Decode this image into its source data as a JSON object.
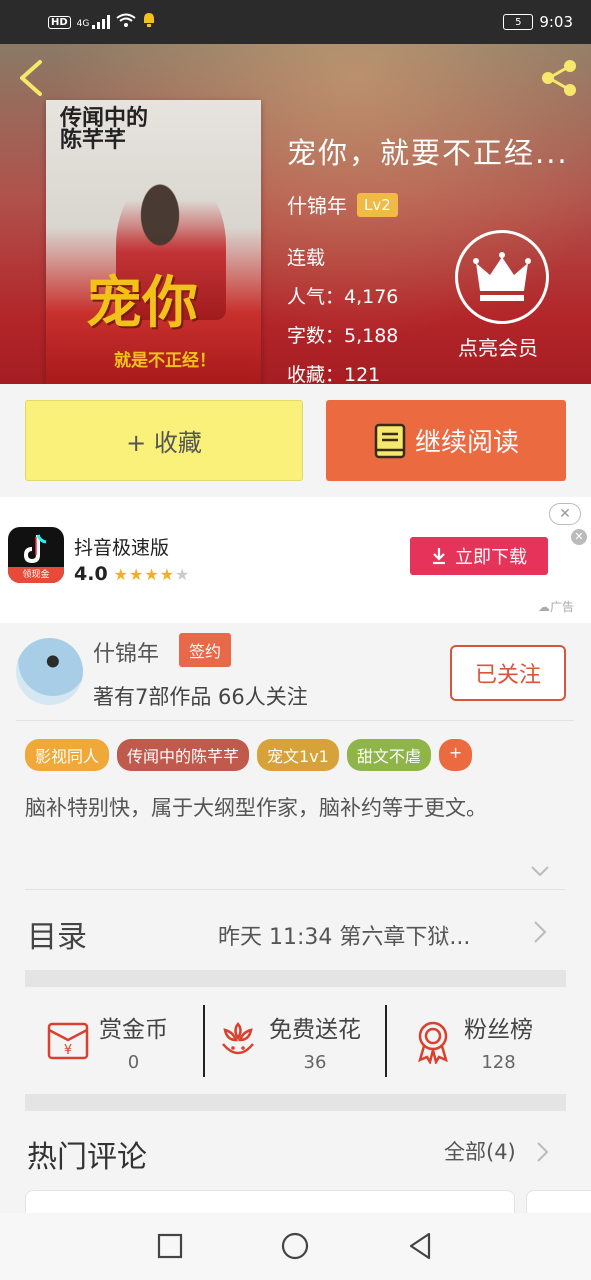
{
  "status_bar": {
    "network_tag": "HD",
    "signal": "4G",
    "battery": "5",
    "time": "9:03"
  },
  "book": {
    "title": "宠你，就要不正经...",
    "author": "什锦年",
    "level": "Lv2",
    "status": "连载",
    "popularity": "人气：4,176",
    "word_count": "字数：5,188",
    "favorites": "收藏：121",
    "vip_label": "点亮会员",
    "cover_title": "传闻中的陈芊芊",
    "cover_big": "宠你",
    "cover_sub": "就是不正经！"
  },
  "actions": {
    "collect_label": "+ 收藏",
    "read_label": "继续阅读"
  },
  "ad": {
    "app_name": "抖音极速版",
    "rating": "4.0",
    "icon_badge": "领现金",
    "download_label": "立即下载",
    "ad_label": "广告"
  },
  "author": {
    "name": "什锦年",
    "sign_badge": "签约",
    "works": "著有7部作品 66人关注",
    "follow_label": "已关注",
    "tags": [
      {
        "label": "影视同人",
        "color": "#f0a838"
      },
      {
        "label": "传闻中的陈芊芊",
        "color": "#c05a4d"
      },
      {
        "label": "宠文1v1",
        "color": "#d8a23a"
      },
      {
        "label": "甜文不虐",
        "color": "#8fb54a"
      },
      {
        "label": "+",
        "color": "#ec6a40"
      }
    ],
    "description": "脑补特别快，属于大纲型作家，脑补约等于更文。"
  },
  "catalog": {
    "label": "目录",
    "latest": "昨天 11:34 第六章下狱..."
  },
  "rewards": [
    {
      "label": "赏金币",
      "value": "0"
    },
    {
      "label": "免费送花",
      "value": "36"
    },
    {
      "label": "粉丝榜",
      "value": "128"
    }
  ],
  "comments": {
    "title": "热门评论",
    "all_label": "全部(4)"
  },
  "colors": {
    "accent": "#ec6a40",
    "collect_bg": "#f9f17a",
    "download_bg": "#e5335a",
    "icon_red": "#d9412e"
  }
}
